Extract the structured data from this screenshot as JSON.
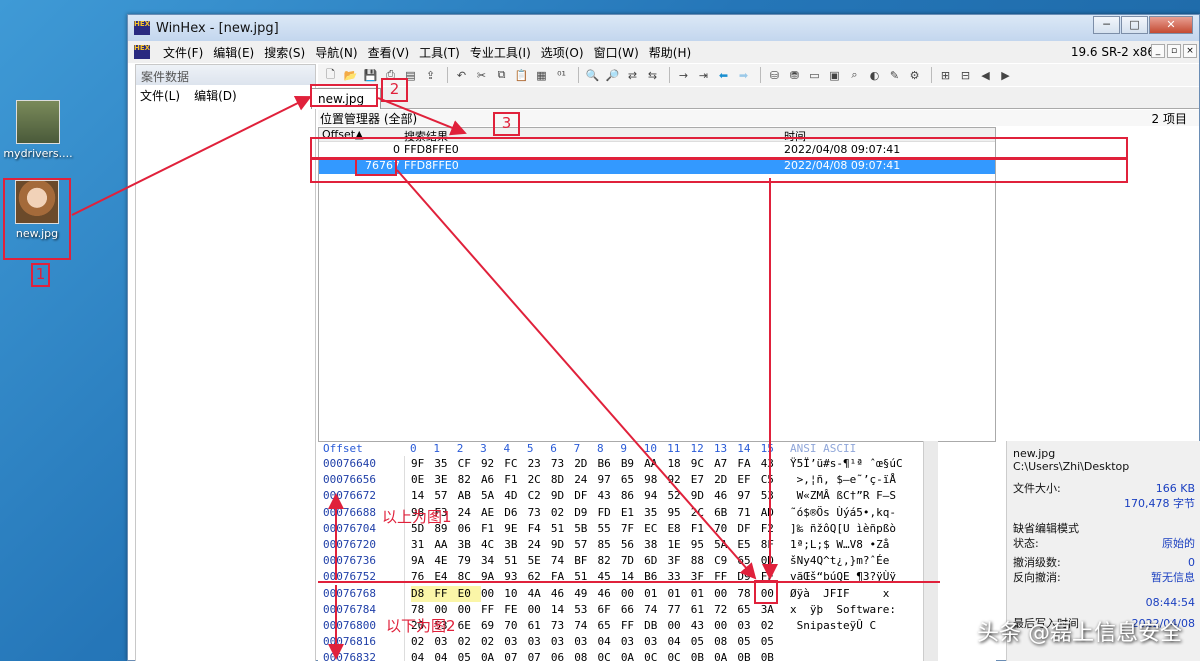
{
  "desktop": {
    "icons": [
      {
        "label": "mydrivers...."
      },
      {
        "label": "new.jpg"
      }
    ]
  },
  "window": {
    "app_logo": "HEX",
    "title": "WinHex - [new.jpg]",
    "controls": {
      "min": "─",
      "max": "□",
      "close": "✕"
    }
  },
  "menubar": {
    "items": [
      "文件(F)",
      "编辑(E)",
      "搜索(S)",
      "导航(N)",
      "查看(V)",
      "工具(T)",
      "专业工具(I)",
      "选项(O)",
      "窗口(W)",
      "帮助(H)"
    ],
    "version": "19.6 SR-2 x86"
  },
  "left_panel": {
    "title": "案件数据",
    "menu": [
      "文件(L)",
      "编辑(D)"
    ]
  },
  "doc_tab": {
    "label": "new.jpg"
  },
  "position_manager": {
    "title": "位置管理器 (全部)",
    "count": "2 项目",
    "columns": [
      "Offset▲",
      "搜索结果",
      "时间"
    ],
    "rows": [
      {
        "offset": "0",
        "result": "FFD8FFE0",
        "time": "2022/04/08  09:07:41",
        "selected": false
      },
      {
        "offset": "76767",
        "result": "FFD8FFE0",
        "time": "2022/04/08  09:07:41",
        "selected": true
      }
    ]
  },
  "hex_view": {
    "header_offset": "Offset",
    "header_cols": [
      "0",
      "1",
      "2",
      "3",
      "4",
      "5",
      "6",
      "7",
      "8",
      "9",
      "10",
      "11",
      "12",
      "13",
      "14",
      "15"
    ],
    "header_ascii": "ANSI ASCII",
    "rows": [
      {
        "offset": "00076640",
        "bytes": [
          "9F",
          "35",
          "CF",
          "92",
          "FC",
          "23",
          "73",
          "2D",
          "B6",
          "B9",
          "AA",
          "18",
          "9C",
          "A7",
          "FA",
          "43"
        ],
        "ascii": "Ÿ5Ï’ü#s-¶¹ª ˆœ§úC"
      },
      {
        "offset": "00076656",
        "bytes": [
          "0E",
          "3E",
          "82",
          "A6",
          "F1",
          "2C",
          "8D",
          "24",
          "97",
          "65",
          "98",
          "92",
          "E7",
          "2D",
          "EF",
          "C5"
        ],
        "ascii": " >‚¦ñ, $—e˜’ç-ïÅ"
      },
      {
        "offset": "00076672",
        "bytes": [
          "14",
          "57",
          "AB",
          "5A",
          "4D",
          "C2",
          "9D",
          "DF",
          "43",
          "86",
          "94",
          "52",
          "9D",
          "46",
          "97",
          "53"
        ],
        "ascii": " W«ZMÂ ßC†”R F—S"
      },
      {
        "offset": "00076688",
        "bytes": [
          "98",
          "F3",
          "24",
          "AE",
          "D6",
          "73",
          "02",
          "D9",
          "FD",
          "E1",
          "35",
          "95",
          "2C",
          "6B",
          "71",
          "AD"
        ],
        "ascii": "˜ó$®Ös Ùýá5•,kq-"
      },
      {
        "offset": "00076704",
        "bytes": [
          "5D",
          "89",
          "06",
          "F1",
          "9E",
          "F4",
          "51",
          "5B",
          "55",
          "7F",
          "EC",
          "E8",
          "F1",
          "70",
          "DF",
          "F2"
        ],
        "ascii": "]‰ ñžôQ[U ìèñpßò"
      },
      {
        "offset": "00076720",
        "bytes": [
          "31",
          "AA",
          "3B",
          "4C",
          "3B",
          "24",
          "9D",
          "57",
          "85",
          "56",
          "38",
          "1E",
          "95",
          "5A",
          "E5",
          "8F"
        ],
        "ascii": "1ª;L;$ W…V8 •Zå "
      },
      {
        "offset": "00076736",
        "bytes": [
          "9A",
          "4E",
          "79",
          "34",
          "51",
          "5E",
          "74",
          "BF",
          "82",
          "7D",
          "6D",
          "3F",
          "88",
          "C9",
          "65",
          "0D"
        ],
        "ascii": "šNy4Q^t¿‚}m?ˆÉe "
      },
      {
        "offset": "00076752",
        "bytes": [
          "76",
          "E4",
          "8C",
          "9A",
          "93",
          "62",
          "FA",
          "51",
          "45",
          "14",
          "B6",
          "33",
          "3F",
          "FF",
          "D9",
          "FF"
        ],
        "ascii": "vãŒš“búQE ¶3?ÿÙÿ"
      },
      {
        "offset": "00076768",
        "bytes": [
          "D8",
          "FF",
          "E0",
          "00",
          "10",
          "4A",
          "46",
          "49",
          "46",
          "00",
          "01",
          "01",
          "01",
          "00",
          "78",
          "00"
        ],
        "ascii": "Øÿà  JFIF     x "
      },
      {
        "offset": "00076784",
        "bytes": [
          "78",
          "00",
          "00",
          "FF",
          "FE",
          "00",
          "14",
          "53",
          "6F",
          "66",
          "74",
          "77",
          "61",
          "72",
          "65",
          "3A"
        ],
        "ascii": "x  ÿþ  Software:"
      },
      {
        "offset": "00076800",
        "bytes": [
          "20",
          "53",
          "6E",
          "69",
          "70",
          "61",
          "73",
          "74",
          "65",
          "FF",
          "DB",
          "00",
          "43",
          "00",
          "03",
          "02"
        ],
        "ascii": " SnipasteÿÛ C   "
      },
      {
        "offset": "00076816",
        "bytes": [
          "02",
          "03",
          "02",
          "02",
          "03",
          "03",
          "03",
          "03",
          "04",
          "03",
          "03",
          "04",
          "05",
          "08",
          "05",
          "05"
        ],
        "ascii": "                "
      },
      {
        "offset": "00076832",
        "bytes": [
          "04",
          "04",
          "05",
          "0A",
          "07",
          "07",
          "06",
          "08",
          "0C",
          "0A",
          "0C",
          "0C",
          "0B",
          "0A",
          "0B",
          "0B"
        ],
        "ascii": "                "
      }
    ]
  },
  "info_panel": {
    "filename": "new.jpg",
    "path": "C:\\Users\\Zhi\\Desktop",
    "size_label": "文件大小:",
    "size_kb": "166 KB",
    "size_bytes": "170,478 字节",
    "edit_mode_label": "缺省编辑模式",
    "state_label": "状态:",
    "state_value": "原始的",
    "undo_label": "撤消级数:",
    "undo_value": "0",
    "redo_label": "反向撤消:",
    "redo_value": "暂无信息",
    "time_value": "08:44:54",
    "last_write_label": "最后写入时间",
    "last_write_value": "2022/04/08"
  },
  "annotations": {
    "box1": "1",
    "box2": "2",
    "box3": "3",
    "note1": "以上为图1",
    "note2": "以下为图2"
  },
  "watermark": "头条 @磊上信息安全"
}
